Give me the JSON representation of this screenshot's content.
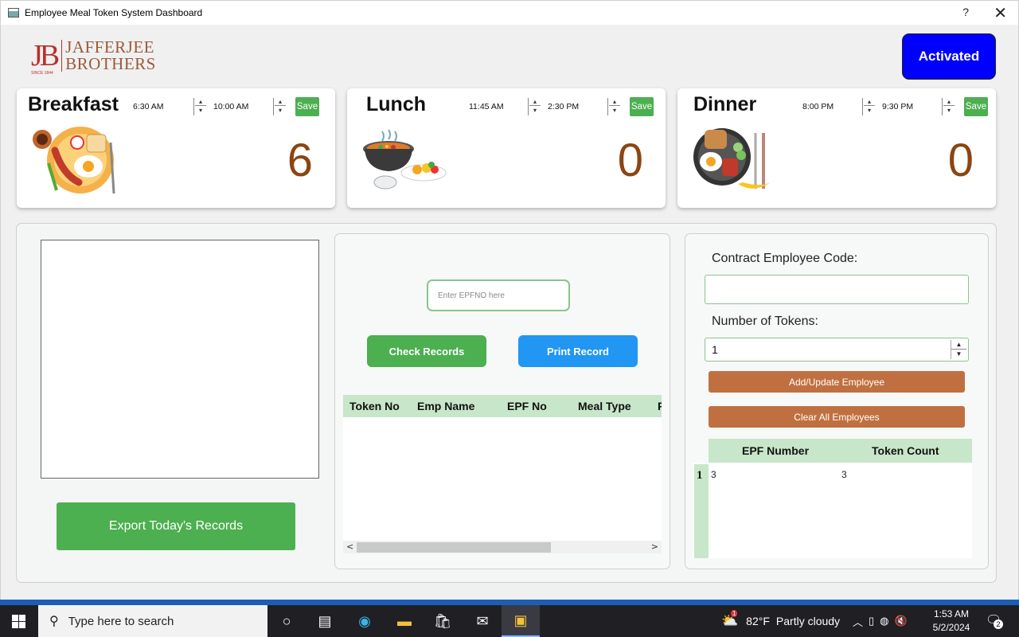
{
  "window": {
    "title": "Employee Meal Token System Dashboard",
    "help": "?",
    "close": "✕"
  },
  "logo": {
    "initials": "JB",
    "since": "SINCE 1844",
    "line1": "JAFFERJEE",
    "line2": "BROTHERS"
  },
  "status": {
    "label": "Activated",
    "color": "#0000ff"
  },
  "meals": [
    {
      "name": "Breakfast",
      "start": "6:30 AM",
      "end": "10:00 AM",
      "save": "Save",
      "count": "6",
      "icon": "breakfast-plate-icon"
    },
    {
      "name": "Lunch",
      "start": "11:45 AM",
      "end": "2:30 PM",
      "save": "Save",
      "count": "0",
      "icon": "lunch-pot-icon"
    },
    {
      "name": "Dinner",
      "start": "8:00 PM",
      "end": "9:30 PM",
      "save": "Save",
      "count": "0",
      "icon": "dinner-plate-icon"
    }
  ],
  "export_label": "Export Today's Records",
  "records": {
    "epf_placeholder": "Enter EPFNO here",
    "check_label": "Check Records",
    "print_label": "Print Record",
    "columns": [
      "Token No",
      "Emp Name",
      "EPF No",
      "Meal Type",
      "P"
    ]
  },
  "contract": {
    "code_label": "Contract Employee Code:",
    "code_value": "",
    "tokens_label": "Number of Tokens:",
    "tokens_value": "1",
    "add_label": "Add/Update Employee",
    "clear_label": "Clear All Employees",
    "columns": [
      "EPF Number",
      "Token Count"
    ],
    "rows": [
      {
        "index": "1",
        "epf": "3",
        "tokens": "3"
      }
    ]
  },
  "taskbar": {
    "search_placeholder": "Type here to search",
    "weather_temp": "82°F",
    "weather_text": "Partly cloudy",
    "weather_badge": "1",
    "time": "1:53 AM",
    "date": "5/2/2024",
    "notifications": "2"
  },
  "colors": {
    "green": "#4caf50",
    "blue": "#2196f3",
    "brown": "#c07040",
    "header_green": "#c8e6c9",
    "count_brown": "#8b4513"
  }
}
